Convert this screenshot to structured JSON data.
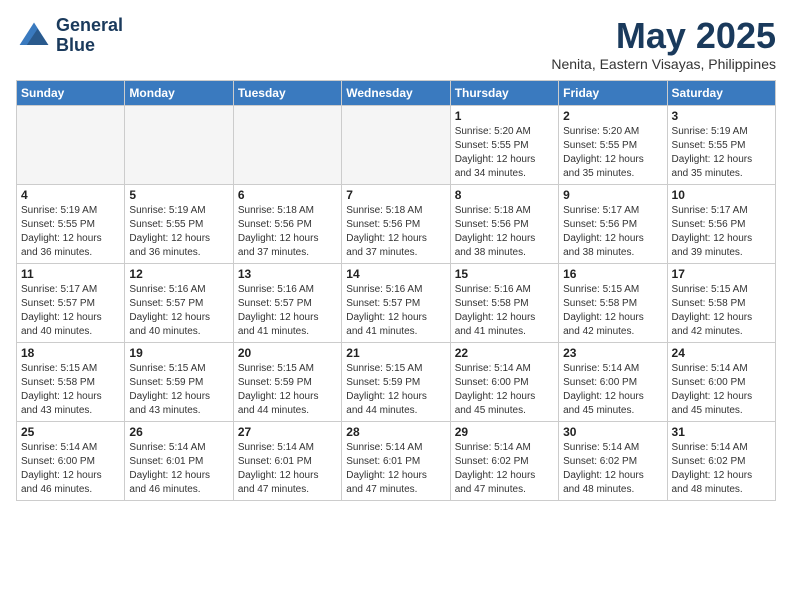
{
  "header": {
    "logo_line1": "General",
    "logo_line2": "Blue",
    "month": "May 2025",
    "location": "Nenita, Eastern Visayas, Philippines"
  },
  "weekdays": [
    "Sunday",
    "Monday",
    "Tuesday",
    "Wednesday",
    "Thursday",
    "Friday",
    "Saturday"
  ],
  "weeks": [
    [
      {
        "day": "",
        "info": ""
      },
      {
        "day": "",
        "info": ""
      },
      {
        "day": "",
        "info": ""
      },
      {
        "day": "",
        "info": ""
      },
      {
        "day": "1",
        "info": "Sunrise: 5:20 AM\nSunset: 5:55 PM\nDaylight: 12 hours\nand 34 minutes."
      },
      {
        "day": "2",
        "info": "Sunrise: 5:20 AM\nSunset: 5:55 PM\nDaylight: 12 hours\nand 35 minutes."
      },
      {
        "day": "3",
        "info": "Sunrise: 5:19 AM\nSunset: 5:55 PM\nDaylight: 12 hours\nand 35 minutes."
      }
    ],
    [
      {
        "day": "4",
        "info": "Sunrise: 5:19 AM\nSunset: 5:55 PM\nDaylight: 12 hours\nand 36 minutes."
      },
      {
        "day": "5",
        "info": "Sunrise: 5:19 AM\nSunset: 5:55 PM\nDaylight: 12 hours\nand 36 minutes."
      },
      {
        "day": "6",
        "info": "Sunrise: 5:18 AM\nSunset: 5:56 PM\nDaylight: 12 hours\nand 37 minutes."
      },
      {
        "day": "7",
        "info": "Sunrise: 5:18 AM\nSunset: 5:56 PM\nDaylight: 12 hours\nand 37 minutes."
      },
      {
        "day": "8",
        "info": "Sunrise: 5:18 AM\nSunset: 5:56 PM\nDaylight: 12 hours\nand 38 minutes."
      },
      {
        "day": "9",
        "info": "Sunrise: 5:17 AM\nSunset: 5:56 PM\nDaylight: 12 hours\nand 38 minutes."
      },
      {
        "day": "10",
        "info": "Sunrise: 5:17 AM\nSunset: 5:56 PM\nDaylight: 12 hours\nand 39 minutes."
      }
    ],
    [
      {
        "day": "11",
        "info": "Sunrise: 5:17 AM\nSunset: 5:57 PM\nDaylight: 12 hours\nand 40 minutes."
      },
      {
        "day": "12",
        "info": "Sunrise: 5:16 AM\nSunset: 5:57 PM\nDaylight: 12 hours\nand 40 minutes."
      },
      {
        "day": "13",
        "info": "Sunrise: 5:16 AM\nSunset: 5:57 PM\nDaylight: 12 hours\nand 41 minutes."
      },
      {
        "day": "14",
        "info": "Sunrise: 5:16 AM\nSunset: 5:57 PM\nDaylight: 12 hours\nand 41 minutes."
      },
      {
        "day": "15",
        "info": "Sunrise: 5:16 AM\nSunset: 5:58 PM\nDaylight: 12 hours\nand 41 minutes."
      },
      {
        "day": "16",
        "info": "Sunrise: 5:15 AM\nSunset: 5:58 PM\nDaylight: 12 hours\nand 42 minutes."
      },
      {
        "day": "17",
        "info": "Sunrise: 5:15 AM\nSunset: 5:58 PM\nDaylight: 12 hours\nand 42 minutes."
      }
    ],
    [
      {
        "day": "18",
        "info": "Sunrise: 5:15 AM\nSunset: 5:58 PM\nDaylight: 12 hours\nand 43 minutes."
      },
      {
        "day": "19",
        "info": "Sunrise: 5:15 AM\nSunset: 5:59 PM\nDaylight: 12 hours\nand 43 minutes."
      },
      {
        "day": "20",
        "info": "Sunrise: 5:15 AM\nSunset: 5:59 PM\nDaylight: 12 hours\nand 44 minutes."
      },
      {
        "day": "21",
        "info": "Sunrise: 5:15 AM\nSunset: 5:59 PM\nDaylight: 12 hours\nand 44 minutes."
      },
      {
        "day": "22",
        "info": "Sunrise: 5:14 AM\nSunset: 6:00 PM\nDaylight: 12 hours\nand 45 minutes."
      },
      {
        "day": "23",
        "info": "Sunrise: 5:14 AM\nSunset: 6:00 PM\nDaylight: 12 hours\nand 45 minutes."
      },
      {
        "day": "24",
        "info": "Sunrise: 5:14 AM\nSunset: 6:00 PM\nDaylight: 12 hours\nand 45 minutes."
      }
    ],
    [
      {
        "day": "25",
        "info": "Sunrise: 5:14 AM\nSunset: 6:00 PM\nDaylight: 12 hours\nand 46 minutes."
      },
      {
        "day": "26",
        "info": "Sunrise: 5:14 AM\nSunset: 6:01 PM\nDaylight: 12 hours\nand 46 minutes."
      },
      {
        "day": "27",
        "info": "Sunrise: 5:14 AM\nSunset: 6:01 PM\nDaylight: 12 hours\nand 47 minutes."
      },
      {
        "day": "28",
        "info": "Sunrise: 5:14 AM\nSunset: 6:01 PM\nDaylight: 12 hours\nand 47 minutes."
      },
      {
        "day": "29",
        "info": "Sunrise: 5:14 AM\nSunset: 6:02 PM\nDaylight: 12 hours\nand 47 minutes."
      },
      {
        "day": "30",
        "info": "Sunrise: 5:14 AM\nSunset: 6:02 PM\nDaylight: 12 hours\nand 48 minutes."
      },
      {
        "day": "31",
        "info": "Sunrise: 5:14 AM\nSunset: 6:02 PM\nDaylight: 12 hours\nand 48 minutes."
      }
    ]
  ]
}
